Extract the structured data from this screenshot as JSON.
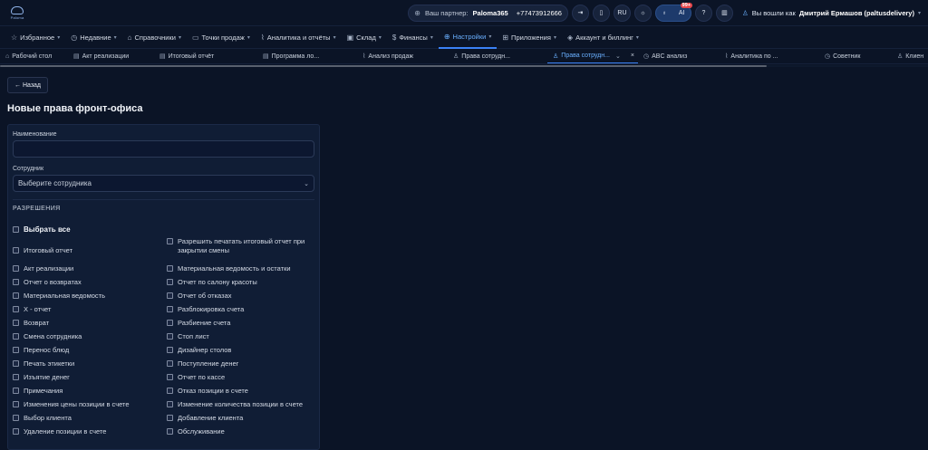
{
  "topbar": {
    "logo_caption": "Paloma",
    "partner_label": "Ваш партнер:",
    "partner_name": "Paloma365",
    "partner_phone": "+77473912666",
    "lang": "RU",
    "ai_label": "AI",
    "ai_badge": "99+",
    "user_text": "Вы вошли как",
    "user_name": "Дмитрий Ермашов (paltusdelivery)"
  },
  "menu": [
    {
      "icon": "star-icon",
      "glyph": "☆",
      "label": "Избранное"
    },
    {
      "icon": "clock-icon",
      "glyph": "◷",
      "label": "Недавние"
    },
    {
      "icon": "tag-icon",
      "glyph": "⌂",
      "label": "Справочники"
    },
    {
      "icon": "monitor-icon",
      "glyph": "▭",
      "label": "Точки продаж"
    },
    {
      "icon": "chart-icon",
      "glyph": "⌇",
      "label": "Аналитика и отчёты"
    },
    {
      "icon": "box-icon",
      "glyph": "▣",
      "label": "Склад"
    },
    {
      "icon": "dollar-icon",
      "glyph": "$",
      "label": "Финансы"
    },
    {
      "icon": "globe-icon",
      "glyph": "⊕",
      "label": "Настройки",
      "active": true
    },
    {
      "icon": "grid-icon",
      "glyph": "⊞",
      "label": "Приложения"
    },
    {
      "icon": "wallet-icon",
      "glyph": "◈",
      "label": "Аккаунт и биллинг"
    }
  ],
  "tabs": [
    {
      "label": "Рабочий стол",
      "glyph": "⌂"
    },
    {
      "label": "Акт реализации",
      "glyph": "▤"
    },
    {
      "label": "Итоговый отчёт",
      "glyph": "▤"
    },
    {
      "label": "Программа ло...",
      "glyph": "▤"
    },
    {
      "label": "Анализ продаж",
      "glyph": "⌇"
    },
    {
      "label": "Права сотрудн...",
      "glyph": "♙"
    },
    {
      "label": "Права сотрудн...",
      "glyph": "♙",
      "active": true
    },
    {
      "label": "ABC анализ",
      "glyph": "◷"
    },
    {
      "label": "Аналитика по ...",
      "glyph": "⌇"
    },
    {
      "label": "Советник",
      "glyph": "◷"
    },
    {
      "label": "Клиен",
      "glyph": "♙"
    }
  ],
  "page": {
    "back_label": "← Назад",
    "title": "Новые права фронт-офиса",
    "name_label": "Наименование",
    "name_value": "",
    "employee_label": "Сотрудник",
    "employee_placeholder": "Выберите сотрудника",
    "permissions_heading": "РАЗРЕШЕНИЯ",
    "select_all": "Выбрать все"
  },
  "permissions_left": [
    "Итоговый отчет",
    "Акт реализации",
    "Отчет о возвратах",
    "Материальная ведомость",
    "X - отчет",
    "Возврат",
    "Смена сотрудника",
    "Перенос блюд",
    "Печать этикетки",
    "Изъятие денег",
    "Примечания",
    "Изменения цены позиции в счете",
    "Выбор клиента",
    "Удаление позиции в счете"
  ],
  "permissions_right": [
    "Разрешить печатать итоговый отчет при закрытии смены",
    "Материальная ведомость и остатки",
    "Отчет по салону красоты",
    "Отчет об отказах",
    "Разблокировка счета",
    "Разбиение счета",
    "Стоп лист",
    "Дизайнер столов",
    "Поступление денег",
    "Отчет по кассе",
    "Отказ позиции в счете",
    "Изменение количества позиции в счете",
    "Добавление клиента",
    "Обслуживание"
  ]
}
